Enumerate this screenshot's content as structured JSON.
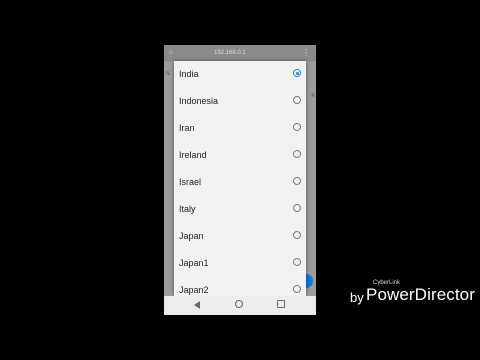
{
  "status_bar": {
    "url": "192.168.0.1"
  },
  "background": {
    "left_text": "N",
    "right_text": "R"
  },
  "country_dialog": {
    "options": [
      {
        "label": "India",
        "selected": true
      },
      {
        "label": "Indonesia",
        "selected": false
      },
      {
        "label": "Iran",
        "selected": false
      },
      {
        "label": "Ireland",
        "selected": false
      },
      {
        "label": "Israel",
        "selected": false
      },
      {
        "label": "Italy",
        "selected": false
      },
      {
        "label": "Japan",
        "selected": false
      },
      {
        "label": "Japan1",
        "selected": false
      },
      {
        "label": "Japan2",
        "selected": false
      }
    ]
  },
  "nav_bar": {
    "icons": [
      "back-icon",
      "home-icon",
      "recents-icon"
    ]
  },
  "watermark": {
    "by": "by",
    "small": "CyberLink",
    "brand": "PowerDirector"
  },
  "colors": {
    "accent": "#1e88e5",
    "dialog_bg": "#f1f1f1",
    "page_bg": "#000000"
  }
}
